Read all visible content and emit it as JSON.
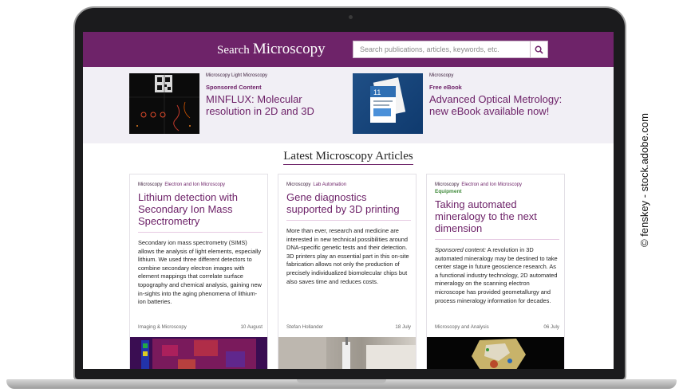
{
  "header": {
    "brand_search": "Search",
    "brand_name": "Microscopy",
    "search_placeholder": "Search publications, articles, keywords, etc."
  },
  "promos": [
    {
      "category": "Microscopy  Light Microscopy",
      "type": "Sponsored Content",
      "title": "MINFLUX: Molecular resolution in 2D and 3D"
    },
    {
      "category": "Microscopy",
      "type": "Free eBook",
      "title": "Advanced Optical Metrology: new eBook available now!"
    }
  ],
  "section_title": "Latest Microscopy Articles",
  "articles": [
    {
      "cat1": "Microscopy",
      "cat2": "Electron and Ion Microscopy",
      "badge": "",
      "title": "Lithium detection with Secondary Ion Mass Spectrometry",
      "lead": "",
      "body": "Secondary ion mass spectrometry (SIMS) allows the analysis of light elements, especially lithium. We used three different detectors to combine secondary electron images with element mappings that correlate surface topography and chemical analysis, gaining new in-sights into the aging phenomena of lithium-ion batteries.",
      "author": "Imaging & Microscopy",
      "date": "10 August"
    },
    {
      "cat1": "Microscopy",
      "cat2": "Lab Automation",
      "badge": "",
      "title": "Gene diagnostics supported by 3D printing",
      "lead": "",
      "body": "More than ever, research and medicine are interested in new technical possibilities around DNA-specific genetic tests and their detection. 3D printers play an essential part in this on-site fabrication allows not only the production of precisely individualized biomolecular chips but also saves time and reduces costs.",
      "author": "Stefan Hollander",
      "date": "18 July"
    },
    {
      "cat1": "Microscopy",
      "cat2": "Electron and Ion Microscopy",
      "badge": "Equipment",
      "title": "Taking automated mineralogy to the next dimension",
      "lead": "Sponsored content:",
      "body": " A revolution in 3D automated mineralogy may be destined to take center stage in future geoscience research. As a functional industry technology, 2D automated mineralogy on the scanning electron microscope has provided geometallurgy and process mineralogy information for decades.",
      "author": "Microscopy and Analysis",
      "date": "06 July"
    }
  ],
  "credit": "© fenskey - stock.adobe.com"
}
